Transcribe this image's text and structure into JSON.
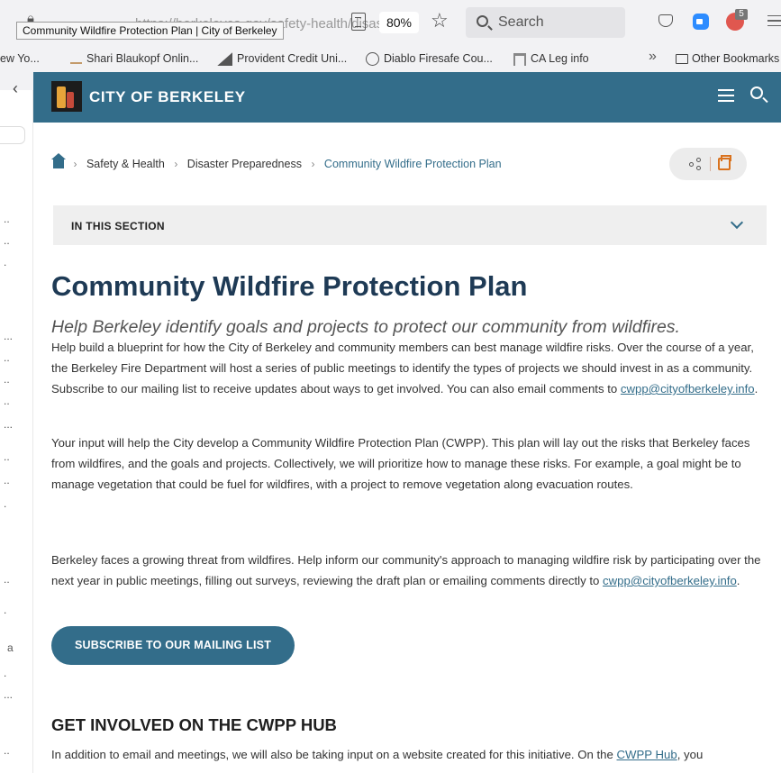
{
  "browser": {
    "url": "https://berkeleyca.gov/safety-health/disaster-p",
    "tooltip": "Community Wildfire Protection Plan | City of Berkeley",
    "zoom": "80%",
    "search_placeholder": "Search",
    "extension_badge_count": "5",
    "bookmarks": [
      {
        "label": "ew Yo...",
        "icon": "page-icon"
      },
      {
        "label": "Shari Blaukopf Onlin...",
        "icon": "site-icon"
      },
      {
        "label": "Provident Credit Uni...",
        "icon": "site-icon"
      },
      {
        "label": "Diablo Firesafe Cou...",
        "icon": "globe-icon"
      },
      {
        "label": "CA Leg info",
        "icon": "building-icon"
      }
    ],
    "bookmarks_overflow": "»",
    "other_bookmarks": "Other Bookmarks"
  },
  "left_strip": {
    "items": [
      "..",
      "..",
      ".",
      "...",
      "..",
      "..",
      "..",
      "...",
      "..",
      "..",
      ".",
      "..",
      ".",
      "a",
      ".",
      "...",
      ".."
    ]
  },
  "site": {
    "name": "CITY OF BERKELEY",
    "accent_color": "#336d8a"
  },
  "breadcrumb": {
    "items": [
      "Safety & Health",
      "Disaster Preparedness"
    ],
    "current": "Community Wildfire Protection Plan"
  },
  "section": {
    "label": "IN THIS SECTION"
  },
  "main": {
    "title": "Community Wildfire Protection Plan",
    "subtitle": "Help Berkeley identify goals and projects to protect our community from wildfires.",
    "para1_text": "Help build a blueprint for how the City of Berkeley and community members can best manage wildfire risks. Over the course of a year, the Berkeley Fire Department will host a series of public meetings to identify the types of projects we should invest in as a community. Subscribe to our mailing list to receive updates about ways to get involved. You can also email comments to ",
    "para1_link": "cwpp@cityofberkeley.info",
    "para1_end": ".",
    "para2_text": "Your input will help the City develop a Community Wildfire Protection Plan (CWPP). This plan will lay out the risks that Berkeley faces from wildfires, and the goals and projects. Collectively, we will prioritize how to manage these risks. For example, a goal might be to manage vegetation that could be fuel for wildfires, with a project to remove vegetation along evacuation routes.",
    "para3_text": "Berkeley faces a growing threat from wildfires. Help inform our community's approach to managing wildfire risk by participating over the next year in public meetings, filling out surveys, reviewing the draft plan or emailing comments directly to ",
    "para3_link": "cwpp@cityofberkeley.info",
    "para3_end": ".",
    "subscribe_label": "SUBSCRIBE TO OUR MAILING LIST",
    "hub_heading": "GET INVOLVED ON THE CWPP HUB",
    "hub_text": "In addition to email and meetings, we will also be taking input on a website created for this initiative. On the ",
    "hub_link": "CWPP Hub",
    "hub_end": ", you"
  }
}
